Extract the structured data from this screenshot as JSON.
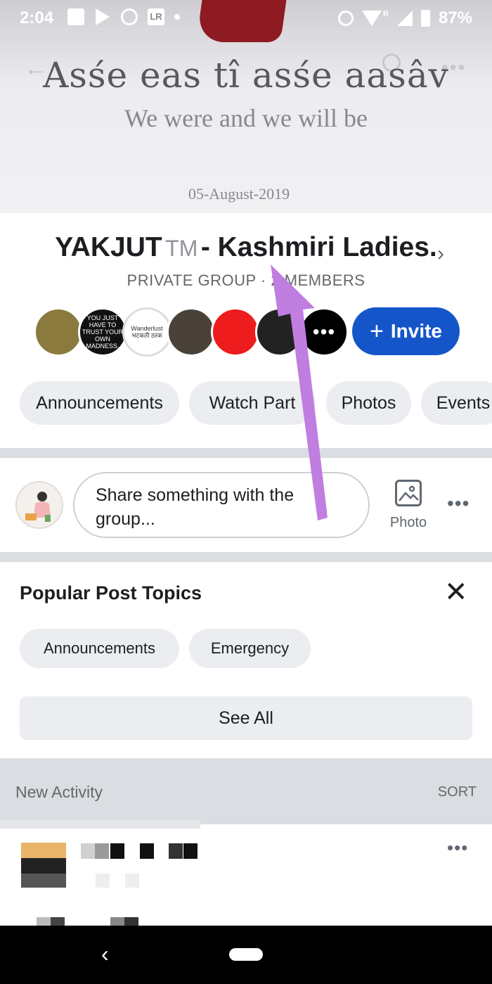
{
  "status_bar": {
    "time": "2:04",
    "lr_badge": "LR",
    "signal_badge": "R",
    "battery": "87%"
  },
  "cover": {
    "title": "Asśe eas tî asśe aasâv",
    "subtitle": "We were and we will be",
    "date": "05-August-2019"
  },
  "group": {
    "name": "YAKJUT",
    "tm": "TM",
    "name_suffix": "- Kashmiri Ladies.",
    "meta": "PRIVATE GROUP · 2 MEMBERS",
    "invite_label": "Invite"
  },
  "avatars": [
    {
      "label": "",
      "color": "#8a7a3e"
    },
    {
      "label": "YOU JUST HAVE TO TRUST YOUR OWN MADNESS.",
      "color": "#111111"
    },
    {
      "label": "Wanderlust भटकती ठरक",
      "color": "#ffffff"
    },
    {
      "label": "",
      "color": "#4a4138"
    },
    {
      "label": "",
      "color": "#ee1c1c"
    },
    {
      "label": "",
      "color": "#222222"
    },
    {
      "label": "•••",
      "color": "#000000"
    }
  ],
  "tabs": [
    "Announcements",
    "Watch Part",
    "Photos",
    "Events"
  ],
  "composer": {
    "placeholder": "Share something with the group...",
    "photo_label": "Photo"
  },
  "popular_topics": {
    "title": "Popular Post Topics",
    "topics": [
      "Announcements",
      "Emergency"
    ],
    "see_all": "See All"
  },
  "activity": {
    "label": "New Activity",
    "sort": "SORT"
  }
}
